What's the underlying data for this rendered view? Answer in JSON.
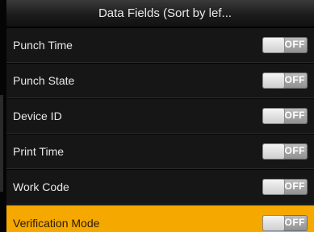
{
  "header": {
    "title": "Data Fields (Sort by lef..."
  },
  "items": [
    {
      "label": "Punch Time",
      "toggle": "OFF"
    },
    {
      "label": "Punch State",
      "toggle": "OFF"
    },
    {
      "label": "Device ID",
      "toggle": "OFF"
    },
    {
      "label": "Print Time",
      "toggle": "OFF"
    },
    {
      "label": "Work Code",
      "toggle": "OFF"
    },
    {
      "label": "Verification Mode",
      "toggle": "OFF"
    }
  ],
  "colors": {
    "selected_row": "#f5a800",
    "row_background": "#161616",
    "header_background": "#2a2a2a"
  }
}
